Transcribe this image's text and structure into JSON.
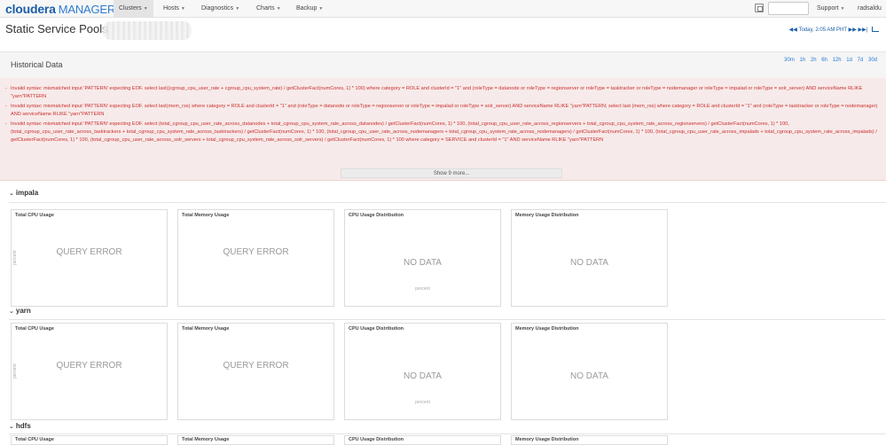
{
  "app": {
    "brand": "cloudera",
    "product": "MANAGER"
  },
  "nav": {
    "items": [
      {
        "label": "Clusters",
        "active": true
      },
      {
        "label": "Hosts",
        "active": false
      },
      {
        "label": "Diagnostics",
        "active": false
      },
      {
        "label": "Charts",
        "active": false
      },
      {
        "label": "Backup",
        "active": false
      }
    ],
    "support": "Support",
    "user": "radsaldu",
    "search_value": ""
  },
  "page": {
    "title": "Static Service Pools",
    "time": "Today, 2:05 AM PHT"
  },
  "historical": {
    "title": "Historical Data",
    "ranges": [
      "30m",
      "1h",
      "2h",
      "6h",
      "12h",
      "1d",
      "7d",
      "30d"
    ],
    "errors": [
      "Invalid syntax: mismatched input 'PATTERN' expecting EOF. select last((cgroup_cpu_user_rate + cgroup_cpu_system_rate) / getClusterFact(numCores, 1) * 100) where category = ROLE and clusterId = \"1\" and (roleType = datanode or roleType = regionserver or roleType = tasktracker or roleType = nodemanager or roleType = impalad or roleType = solr_server) AND serviceName RLIKE \"yarn\"PATTERN",
      "Invalid syntax: mismatched input 'PATTERN' expecting EOF. select last(mem_rss) where category = ROLE and clusterId = \"1\" and (roleType = datanode or roleType = regionserver or roleType = impalad or roleType = solr_server) AND serviceName RLIKE \"yarn\"PATTERN; select last (mem_rss) where category = ROLE and clusterId = \"1\" and (roleType = tasktracker or roleType = nodemanager) AND serviceName RLIKE \"yarn\"PATTERN",
      "Invalid syntax: mismatched input 'PATTERN' expecting EOF. select (total_cgroup_cpu_user_rate_across_datanodes + total_cgroup_cpu_system_rate_across_datanodes) / getClusterFact(numCores, 1) * 100, (total_cgroup_cpu_user_rate_across_regionservers + total_cgroup_cpu_system_rate_across_regionservers) / getClusterFact(numCores, 1) * 100, (total_cgroup_cpu_user_rate_across_tasktrackers + total_cgroup_cpu_system_rate_across_tasktrackers) / getClusterFact(numCores, 1) * 100, (total_cgroup_cpu_user_rate_across_nodemanagers + total_cgroup_cpu_system_rate_across_nodemanagers) / getClusterFact(numCores, 1) * 100, (total_cgroup_cpu_user_rate_across_impalads + total_cgroup_cpu_system_rate_across_impalads) / getClusterFact(numCores, 1) * 100, (total_cgroup_cpu_user_rate_across_solr_servers + total_cgroup_cpu_system_rate_across_solr_servers) / getClusterFact(numCores, 1) * 100 where category = SERVICE and clusterId = \"1\" AND serviceName RLIKE \"yarn\"PATTERN"
    ],
    "show_more": "Show 9 more..."
  },
  "services": [
    {
      "name": "impala",
      "panels": [
        {
          "title": "Total CPU Usage",
          "message": "QUERY ERROR",
          "ylabel": "percent",
          "xlabel": ""
        },
        {
          "title": "Total Memory Usage",
          "message": "QUERY ERROR",
          "ylabel": "",
          "xlabel": ""
        },
        {
          "title": "CPU Usage Distribution",
          "message": "NO DATA",
          "ylabel": "",
          "xlabel": "percent"
        },
        {
          "title": "Memory Usage Distribution",
          "message": "NO DATA",
          "ylabel": "",
          "xlabel": ""
        }
      ]
    },
    {
      "name": "yarn",
      "panels": [
        {
          "title": "Total CPU Usage",
          "message": "QUERY ERROR",
          "ylabel": "percent",
          "xlabel": ""
        },
        {
          "title": "Total Memory Usage",
          "message": "QUERY ERROR",
          "ylabel": "",
          "xlabel": ""
        },
        {
          "title": "CPU Usage Distribution",
          "message": "NO DATA",
          "ylabel": "",
          "xlabel": "percent"
        },
        {
          "title": "Memory Usage Distribution",
          "message": "NO DATA",
          "ylabel": "",
          "xlabel": ""
        }
      ]
    },
    {
      "name": "hdfs",
      "panels": [
        {
          "title": "Total CPU Usage",
          "message": "",
          "ylabel": "",
          "xlabel": ""
        },
        {
          "title": "Total Memory Usage",
          "message": "",
          "ylabel": "",
          "xlabel": ""
        },
        {
          "title": "CPU Usage Distribution",
          "message": "",
          "ylabel": "",
          "xlabel": ""
        },
        {
          "title": "Memory Usage Distribution",
          "message": "",
          "ylabel": "",
          "xlabel": ""
        }
      ]
    }
  ],
  "colors": {
    "brand": "#1b5ea8",
    "error_text": "#c9302c",
    "error_bg": "#f7eaea",
    "link": "#2a7ad5"
  }
}
